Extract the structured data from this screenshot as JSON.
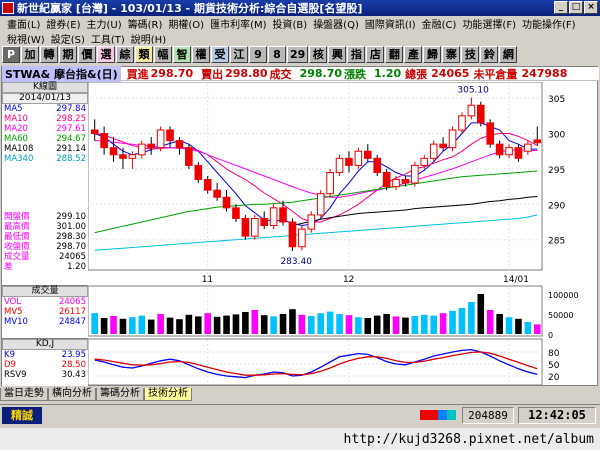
{
  "window": {
    "title": "新世紀贏家 [台灣] - 103/01/13 - 期貨技術分析:綜合自選股[名望股]"
  },
  "menu": {
    "row1": [
      "畫面(L)",
      "證券(E)",
      "主力(U)",
      "籌碼(R)",
      "期權(O)",
      "匯市利率(M)",
      "投資(B)",
      "操盤器(Q)",
      "國際資訊(I)",
      "金融(C)",
      "功能選擇(F)",
      "功能操作(F)"
    ],
    "row2": [
      "稅視(W)",
      "設定(S)",
      "工具(T)",
      "說明(H)"
    ]
  },
  "toolbar": [
    "P",
    "加",
    "轉",
    "期",
    "價",
    "選",
    "綜",
    "類",
    "幅",
    "智",
    "權",
    "受",
    "江",
    "9",
    "8",
    "29",
    "核",
    "興",
    "指",
    "店",
    "翻",
    "產",
    "歸",
    "寨",
    "技",
    "鈴",
    "網"
  ],
  "quote": {
    "symbol": "STWA& 摩台指&(日)",
    "buy_label": "買進",
    "buy": "298.70",
    "sell_label": "賣出",
    "sell": "298.80",
    "deal_label": "成交",
    "deal": "298.70",
    "change_label": "漲跌",
    "change": "1.20",
    "vol_label": "總張",
    "vol": "24065",
    "oi_label": "未平倉量",
    "oi": "247988"
  },
  "left_panel": {
    "header": "K線圖",
    "date": "2014/01/13",
    "ma": [
      {
        "label": "MA5",
        "value": "297.84",
        "color": "#0000ff"
      },
      {
        "label": "MA10",
        "value": "298.25",
        "color": "#ff0080"
      },
      {
        "label": "MA20",
        "value": "297.61",
        "color": "#ff00ff"
      },
      {
        "label": "MA60",
        "value": "294.67",
        "color": "#00a000"
      },
      {
        "label": "MA108",
        "value": "291.14",
        "color": "#000000"
      },
      {
        "label": "MA340",
        "value": "288.52",
        "color": "#00a0c0"
      }
    ],
    "prices": [
      {
        "label": "開盤價",
        "value": "299.10"
      },
      {
        "label": "最高價",
        "value": "301.00"
      },
      {
        "label": "最低價",
        "value": "298.30"
      },
      {
        "label": "收盤價",
        "value": "298.70"
      },
      {
        "label": "成交量",
        "value": "24065"
      },
      {
        "label": "差",
        "value": "1.20"
      }
    ],
    "vol_header": "成交量",
    "vol_ma": [
      {
        "label": "VOL",
        "value": "24065",
        "color": "#ff00ff"
      },
      {
        "label": "MV5",
        "value": "26117",
        "color": "#ff0000"
      },
      {
        "label": "MV10",
        "value": "24847",
        "color": "#0000ff"
      }
    ],
    "kd_header": "KD,J",
    "kd": [
      {
        "label": "K9",
        "value": "23.95",
        "color": "#0000ff"
      },
      {
        "label": "D9",
        "value": "28.50",
        "color": "#ff0000"
      },
      {
        "label": "RSV9",
        "value": "30.43",
        "color": "#000000"
      }
    ]
  },
  "chart_axes": {
    "price_ticks": [
      "305",
      "300",
      "295",
      "290",
      "285"
    ],
    "vol_ticks": [
      "100000",
      "50000",
      "0"
    ],
    "kd_ticks": [
      "80",
      "50",
      "20"
    ],
    "date_labels": [
      "11",
      "12",
      "14/01"
    ],
    "high_label": "305.10",
    "low_label": "283.40"
  },
  "chart_data": {
    "type": "candlestick",
    "ylim": [
      281,
      307
    ],
    "candles": [
      [
        300.5,
        302,
        299,
        300
      ],
      [
        300,
        301,
        297,
        298
      ],
      [
        298,
        299.5,
        296,
        297
      ],
      [
        297,
        298,
        295,
        296.5
      ],
      [
        296.5,
        297.5,
        295,
        297
      ],
      [
        297,
        299,
        296.5,
        298.5
      ],
      [
        298.5,
        299.5,
        297,
        298
      ],
      [
        298,
        301,
        297.5,
        300.5
      ],
      [
        300.5,
        301,
        298,
        299
      ],
      [
        299,
        299.5,
        297,
        298
      ],
      [
        298,
        298.5,
        295,
        295.5
      ],
      [
        295.5,
        296,
        293,
        293.5
      ],
      [
        293.5,
        294,
        291.5,
        292
      ],
      [
        292,
        293,
        290.5,
        291
      ],
      [
        291,
        292,
        289,
        289.5
      ],
      [
        289.5,
        290,
        287.5,
        288
      ],
      [
        288,
        288.5,
        285,
        285.5
      ],
      [
        285.5,
        288.5,
        285,
        288
      ],
      [
        288,
        289,
        286.5,
        287
      ],
      [
        287,
        290,
        286.5,
        289.5
      ],
      [
        289.5,
        290.5,
        287,
        287.5
      ],
      [
        287.5,
        288,
        283.4,
        284
      ],
      [
        284,
        287,
        283.5,
        286.5
      ],
      [
        286.5,
        289,
        286,
        288.5
      ],
      [
        288.5,
        292,
        288,
        291.5
      ],
      [
        291.5,
        295,
        291,
        294.5
      ],
      [
        294.5,
        297,
        294,
        296.5
      ],
      [
        296.5,
        297.5,
        294.5,
        295.5
      ],
      [
        295.5,
        298,
        295,
        297.5
      ],
      [
        297.5,
        298.5,
        296,
        296.5
      ],
      [
        296.5,
        297,
        294,
        294.5
      ],
      [
        294.5,
        295,
        292,
        292.5
      ],
      [
        292.5,
        294,
        292,
        293.5
      ],
      [
        293.5,
        294,
        292.5,
        293
      ],
      [
        293,
        296,
        292.5,
        295.5
      ],
      [
        295.5,
        297,
        295,
        296.5
      ],
      [
        296.5,
        299,
        296,
        298.5
      ],
      [
        298.5,
        299.5,
        297.5,
        298
      ],
      [
        298,
        301,
        297.5,
        300.5
      ],
      [
        300.5,
        303,
        300,
        302.5
      ],
      [
        302.5,
        305.1,
        302,
        304
      ],
      [
        304,
        304.5,
        301,
        301.5
      ],
      [
        301.5,
        302,
        298,
        298.5
      ],
      [
        298.5,
        299,
        296.5,
        297
      ],
      [
        297,
        298.5,
        296.5,
        298
      ],
      [
        298,
        298.5,
        296,
        296.5
      ],
      [
        297.5,
        299,
        297,
        298.5
      ],
      [
        299.1,
        301,
        298.3,
        298.7
      ]
    ],
    "ma_series": [
      {
        "name": "MA5",
        "color": "#0000ff",
        "values": [
          300,
          299.5,
          298.5,
          297.5,
          297,
          297.3,
          297.7,
          298.2,
          298.6,
          299,
          298.5,
          297.5,
          296,
          294.5,
          293,
          291.5,
          289.8,
          288.8,
          287.8,
          287.6,
          287.8,
          287.3,
          287,
          287.2,
          288,
          289.5,
          291.5,
          293,
          294.7,
          296,
          296,
          295.3,
          294.5,
          294,
          294,
          294.8,
          296,
          297.5,
          298.5,
          300,
          301.5,
          301.5,
          301,
          300.5,
          299,
          298.5,
          297.8,
          297.8
        ]
      },
      {
        "name": "MA10",
        "color": "#ff0080",
        "values": [
          300,
          299.8,
          299.3,
          298.8,
          298.3,
          298,
          297.8,
          297.9,
          298,
          298,
          298,
          297.6,
          297,
          296,
          295,
          294.2,
          293.5,
          292.6,
          291.6,
          290.8,
          290,
          289,
          288,
          287.5,
          287.5,
          288,
          288.5,
          289.2,
          290,
          291,
          292,
          293,
          293.7,
          294.3,
          295,
          295.3,
          295.8,
          296.3,
          296.7,
          297.5,
          298.5,
          299.3,
          299.8,
          300,
          300,
          299.6,
          299,
          298.3
        ]
      },
      {
        "name": "MA20",
        "color": "#ff00ff",
        "values": [
          299,
          299,
          298.8,
          298.6,
          298.5,
          298.3,
          298.2,
          298.1,
          298,
          297.9,
          297.8,
          297.5,
          297,
          296.5,
          296,
          295.5,
          295,
          294.5,
          294,
          293.5,
          293,
          292.5,
          292,
          291.6,
          291.3,
          291,
          291,
          291.2,
          291.5,
          291.8,
          292,
          292.3,
          292.6,
          293,
          293.4,
          293.8,
          294.2,
          294.6,
          295,
          295.5,
          296,
          296.5,
          297,
          297.4,
          297.6,
          297.7,
          297.6,
          297.6
        ]
      },
      {
        "name": "MA60",
        "color": "#00a000",
        "values": [
          286,
          286.3,
          286.6,
          286.9,
          287.2,
          287.5,
          287.8,
          288.1,
          288.4,
          288.7,
          289,
          289.2,
          289.4,
          289.6,
          289.7,
          289.8,
          289.9,
          290,
          290,
          290.1,
          290.2,
          290.3,
          290.5,
          290.7,
          290.9,
          291.1,
          291.3,
          291.5,
          291.7,
          291.9,
          292.1,
          292.3,
          292.5,
          292.7,
          292.9,
          293.1,
          293.3,
          293.5,
          293.7,
          293.9,
          294,
          294.1,
          294.2,
          294.3,
          294.4,
          294.5,
          294.6,
          294.7
        ]
      },
      {
        "name": "MA108",
        "color": "#000000",
        "values": [
          null,
          null,
          null,
          null,
          null,
          null,
          null,
          null,
          null,
          null,
          null,
          null,
          null,
          null,
          null,
          null,
          null,
          null,
          null,
          null,
          null,
          287,
          287.3,
          287.6,
          287.9,
          288.1,
          288.3,
          288.5,
          288.7,
          288.8,
          288.9,
          289,
          289.1,
          289.2,
          289.4,
          289.5,
          289.6,
          289.7,
          289.8,
          289.9,
          290,
          290.2,
          290.4,
          290.5,
          290.7,
          290.8,
          291,
          291.1
        ]
      },
      {
        "name": "MA340",
        "color": "#00c0e0",
        "values": [
          283.5,
          283.6,
          283.7,
          283.8,
          283.9,
          284,
          284.1,
          284.2,
          284.3,
          284.4,
          284.5,
          284.6,
          284.7,
          284.8,
          284.9,
          285,
          285.1,
          285.2,
          285.3,
          285.4,
          285.5,
          285.6,
          285.7,
          285.8,
          285.9,
          286,
          286.1,
          286.2,
          286.3,
          286.4,
          286.5,
          286.6,
          286.7,
          286.8,
          286.9,
          287,
          287.1,
          287.2,
          287.3,
          287.4,
          287.5,
          287.6,
          287.7,
          287.8,
          287.9,
          288,
          288.2,
          288.5
        ]
      }
    ],
    "volume": [
      52000,
      40000,
      45000,
      38000,
      42000,
      46000,
      36000,
      50000,
      41000,
      37000,
      48000,
      44000,
      52000,
      43000,
      46000,
      49000,
      55000,
      60000,
      47000,
      44000,
      50000,
      62000,
      48000,
      45000,
      52000,
      56000,
      50000,
      47000,
      42000,
      40000,
      46000,
      50000,
      44000,
      41000,
      45000,
      48000,
      46000,
      52000,
      58000,
      65000,
      80000,
      100000,
      60000,
      50000,
      42000,
      38000,
      30000,
      24065
    ],
    "vol_ylim": [
      0,
      110000
    ],
    "kd_k": [
      60,
      55,
      48,
      42,
      40,
      45,
      52,
      58,
      62,
      58,
      48,
      38,
      30,
      24,
      20,
      18,
      16,
      22,
      25,
      30,
      28,
      20,
      22,
      30,
      42,
      55,
      68,
      72,
      76,
      74,
      66,
      56,
      50,
      48,
      55,
      62,
      70,
      75,
      80,
      84,
      86,
      80,
      70,
      58,
      48,
      38,
      30,
      24
    ],
    "kd_d": [
      62,
      60,
      56,
      52,
      48,
      47,
      48,
      51,
      55,
      56,
      54,
      48,
      42,
      36,
      30,
      26,
      22,
      22,
      23,
      25,
      26,
      24,
      23,
      26,
      32,
      40,
      50,
      58,
      64,
      68,
      68,
      64,
      58,
      54,
      54,
      57,
      62,
      66,
      71,
      75,
      79,
      80,
      77,
      70,
      62,
      54,
      46,
      38
    ],
    "kd_ylim": [
      0,
      100
    ]
  },
  "bottom_tabs": [
    "當日走勢",
    "橫向分析",
    "籌碼分析",
    "技術分析"
  ],
  "status": {
    "left": "精誠",
    "number": "204889",
    "time": "12:42:05"
  },
  "url": "http://kujd3268.pixnet.net/album"
}
